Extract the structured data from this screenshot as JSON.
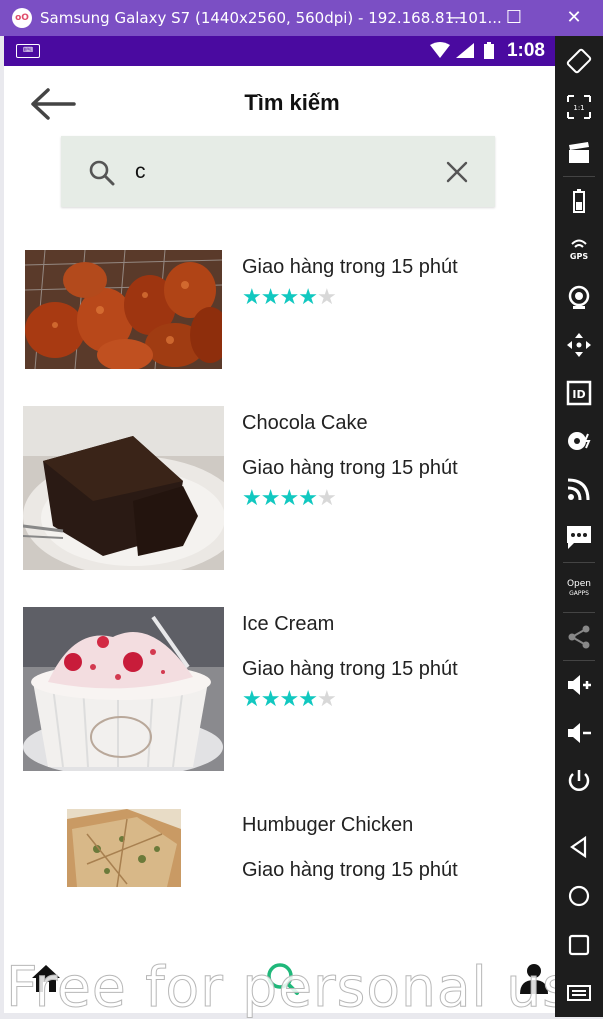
{
  "window": {
    "logo_text": "oO",
    "title": "Samsung Galaxy S7 (1440x2560, 560dpi) - 192.168.81.101...",
    "minimize_label": "—",
    "maximize_label": "☐",
    "close_label": "✕"
  },
  "statusbar": {
    "time": "1:08",
    "keyboard_icon": "keyboard-icon"
  },
  "header": {
    "title": "Tìm kiếm",
    "back_icon": "arrow-left-icon"
  },
  "search": {
    "value": "c",
    "search_icon": "search-icon",
    "clear_icon": "close-icon"
  },
  "results": [
    {
      "name": "",
      "delivery": "Giao hàng trong 15 phút",
      "rating": 4,
      "max_rating": 5,
      "image": "fried-chicken"
    },
    {
      "name": "Chocola Cake",
      "delivery": "Giao hàng trong 15 phút",
      "rating": 4,
      "max_rating": 5,
      "image": "chocolate-cake"
    },
    {
      "name": "Ice Cream",
      "delivery": "Giao hàng trong 15 phút",
      "rating": 4,
      "max_rating": 5,
      "image": "ice-cream"
    },
    {
      "name": "Humbuger Chicken",
      "delivery": "Giao hàng trong 15 phút",
      "image": "pizza"
    }
  ],
  "bottom_nav": {
    "items": [
      "home-icon",
      "search-icon",
      "profile-icon"
    ]
  },
  "watermark": "Free for personal use",
  "colors": {
    "accent": "#11c8c0",
    "statusbar": "#4a0aa0",
    "titlebar": "#7b4fc4",
    "search_bg": "#e6ece6"
  },
  "emulator_sidebar": {
    "items": [
      "rotate-icon",
      "scale-icon",
      "screencast-icon",
      "battery-icon",
      "gps-icon",
      "camera-icon",
      "move-icon",
      "id-icon",
      "media-icon",
      "rss-icon",
      "sms-icon",
      "opengapps-icon",
      "share-icon",
      "volume-up-icon",
      "volume-down-icon",
      "power-icon",
      "back-icon",
      "home-circle-icon",
      "recents-icon",
      "menu-icon"
    ],
    "gps_label": "GPS",
    "id_label": "ID",
    "open_label": "Open",
    "gapps_label": "GAPPS"
  }
}
